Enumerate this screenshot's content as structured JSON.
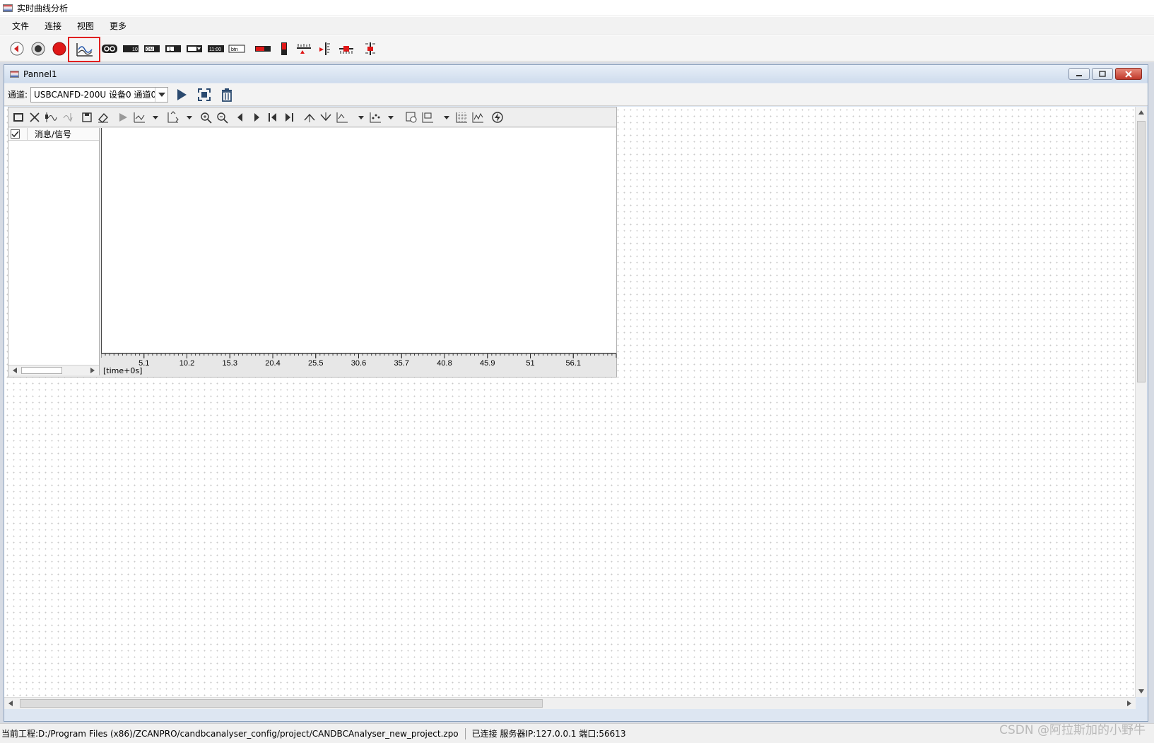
{
  "window": {
    "title": "实时曲线分析"
  },
  "menu": {
    "items": [
      "文件",
      "连接",
      "视图",
      "更多"
    ]
  },
  "toolbar": {
    "buttons": [
      {
        "icon": "back-circle-icon"
      },
      {
        "icon": "stop-circle-icon"
      },
      {
        "icon": "record-red-icon"
      },
      {
        "icon": "curve-chart-icon",
        "selected": true
      },
      {
        "icon": "oo-display-icon"
      },
      {
        "icon": "number-display-icon",
        "text": "10"
      },
      {
        "icon": "on-switch-icon",
        "text": "ON"
      },
      {
        "icon": "one-display-icon",
        "text": "1"
      },
      {
        "icon": "dropdown-widget-icon"
      },
      {
        "icon": "time-display-icon",
        "text": "11:00"
      },
      {
        "icon": "btn-widget-icon",
        "text": "btn"
      },
      {
        "icon": "bar-widget-icon"
      },
      {
        "icon": "vertical-bar-icon"
      },
      {
        "icon": "h-slider-icon"
      },
      {
        "icon": "v-scale-icon"
      },
      {
        "icon": "h-scale-icon"
      },
      {
        "icon": "v-slider-icon"
      }
    ],
    "highlight_color": "#e02020"
  },
  "child_window": {
    "title": "Pannel1",
    "channel_label": "通道:",
    "channel_value": "USBCANFD-200U 设备0 通道0"
  },
  "signal_list": {
    "column_header": "消息/信号"
  },
  "plot": {
    "time_label": "[time+0s]"
  },
  "chart_data": {
    "type": "line",
    "series": [],
    "x_ticks": [
      "5.1",
      "10.2",
      "15.3",
      "20.4",
      "25.5",
      "30.6",
      "35.7",
      "40.8",
      "45.9",
      "51",
      "56.1"
    ],
    "xlim": [
      0,
      61.2
    ]
  },
  "status": {
    "project": "当前工程:D:/Program Files (x86)/ZCANPRO/candbcanalyser_config/project/CANDBCAnalyser_new_project.zpo",
    "connection": "已连接 服务器IP:127.0.0.1 端口:56613"
  },
  "watermark": "CSDN @阿拉斯加的小野牛"
}
